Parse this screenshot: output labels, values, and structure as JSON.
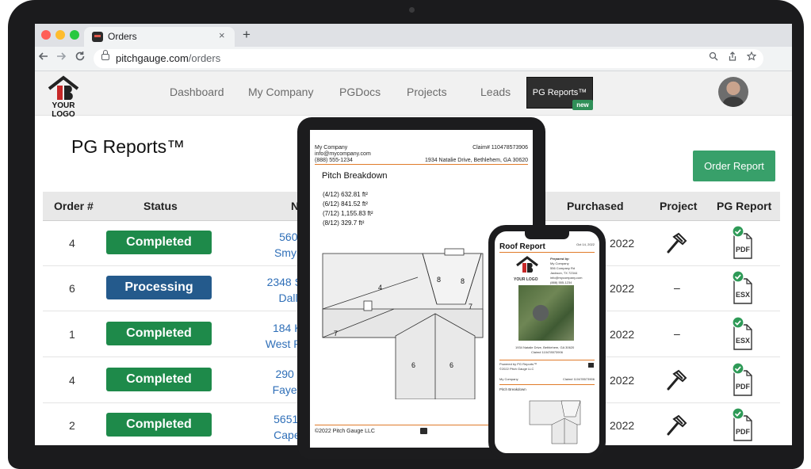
{
  "browser": {
    "tab_title": "Orders",
    "close_glyph": "×",
    "newtab_glyph": "+",
    "url_domain": "pitchgauge.com",
    "url_path": "/orders",
    "icons": [
      "back-arrow-icon",
      "forward-arrow-icon",
      "reload-icon",
      "lock-icon",
      "zoom-icon",
      "share-icon",
      "bookmark-star-icon"
    ]
  },
  "site": {
    "logo_text": "YOUR LOGO",
    "nav": [
      "Dashboard",
      "My Company",
      "PGDocs",
      "Projects",
      "Leads"
    ],
    "active_nav": "PG Reports™",
    "new_badge": "new"
  },
  "page": {
    "title": "PG Reports™",
    "order_button": "Order Report"
  },
  "table": {
    "headers": [
      "Order #",
      "Status",
      "Na",
      "Purchased",
      "Project",
      "PG Report"
    ],
    "rows": [
      {
        "order": "4",
        "status": "Completed",
        "addr1": "560 Floy",
        "addr2": "Smyrna, C",
        "purchased": "2022",
        "project": "hammer",
        "report": "PDF"
      },
      {
        "order": "6",
        "status": "Processing",
        "addr1": "2348 South E",
        "addr2": "Dallas, T",
        "purchased": "2022",
        "project": "–",
        "report": "ESX"
      },
      {
        "order": "1",
        "status": "Completed",
        "addr1": "184 Kensin",
        "addr2": "West Palm Be",
        "purchased": "2022",
        "project": "–",
        "report": "ESX"
      },
      {
        "order": "4",
        "status": "Completed",
        "addr1": "290 Newh",
        "addr2": "Fayetteville",
        "purchased": "2022",
        "project": "hammer",
        "report": "PDF"
      },
      {
        "order": "2",
        "status": "Completed",
        "addr1": "5651 Penn",
        "addr2": "Cape Cora",
        "purchased": "2022",
        "project": "hammer",
        "report": "PDF"
      }
    ]
  },
  "colors": {
    "completed": "#1e8a4a",
    "processing": "#245a8c",
    "link": "#2f6fb8",
    "accent_green": "#38a06a",
    "doc_rule": "#e07b2a"
  },
  "tablet_doc": {
    "company": "My Company",
    "email": "info@mycompany.com",
    "phone": "(888) 555-1234",
    "claim": "Claim# 110478573906",
    "address": "1934 Natalie Drive, Bethlehem, GA 30620",
    "heading": "Pitch Breakdown",
    "pitches": [
      "(4/12) 632.81 ft²",
      "(6/12) 841.52 ft²",
      "(7/12) 1,155.83 ft²",
      "(8/12) 329.7 ft²"
    ],
    "facet_labels": [
      "4",
      "8",
      "8",
      "7",
      "7",
      "6",
      "6"
    ],
    "footer": "©2022 Pitch Gauge LLC"
  },
  "phone_doc": {
    "title": "Roof Report",
    "date": "Oct 14, 2022",
    "prepared_by": "Prepared by:",
    "company": "My Company",
    "street": "556 Company Rd",
    "city": "Jackson, TX 72344",
    "email": "info@mycompany.com",
    "phone": "(888) 555-1234",
    "logo_text": "YOUR LOGO",
    "address": "1934 Natalie Drive, Bethlehem, GA 30620",
    "claim": "Claim# 110478573906",
    "powered": "Powered by PG Reports™",
    "copyright": "©2022 Pitch Gauge LLC",
    "breakdown": "Pitch Breakdown"
  }
}
